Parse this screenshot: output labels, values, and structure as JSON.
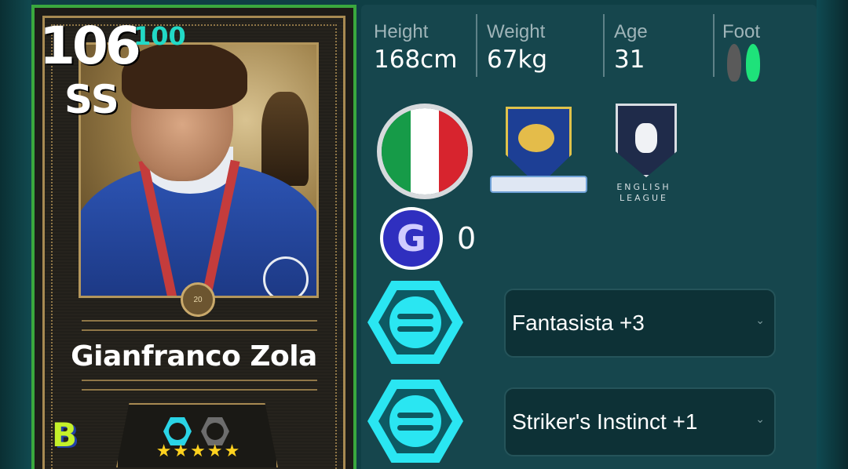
{
  "card": {
    "rating": "106",
    "rating_boost": "100",
    "position": "SS",
    "player_name": "Gianfranco Zola",
    "stars": "★★★★★",
    "medal_number": "20",
    "brand_logo_letter": "B"
  },
  "profile": {
    "height_label": "Height",
    "height_value": "168cm",
    "weight_label": "Weight",
    "weight_value": "67kg",
    "age_label": "Age",
    "age_value": "31",
    "foot_label": "Foot",
    "strong_foot": "right"
  },
  "affiliations": {
    "nationality_flag": "italy-flag",
    "club_emblem": "lion-crest-emblem",
    "league_name": "ENGLISH LEAGUE"
  },
  "currency": {
    "icon_letter": "G",
    "count": "0"
  },
  "skills": [
    {
      "name": "Fantasista +3",
      "icon": "efootball-skill-icon"
    },
    {
      "name": "Striker's Instinct +1",
      "icon": "efootball-skill-icon"
    }
  ],
  "colors": {
    "panel_bg": "#16464d",
    "accent_cyan": "#2ae6f2",
    "foot_active": "#1ee27a",
    "card_gold": "#a88a52",
    "rating_boost": "#22d9c6"
  }
}
